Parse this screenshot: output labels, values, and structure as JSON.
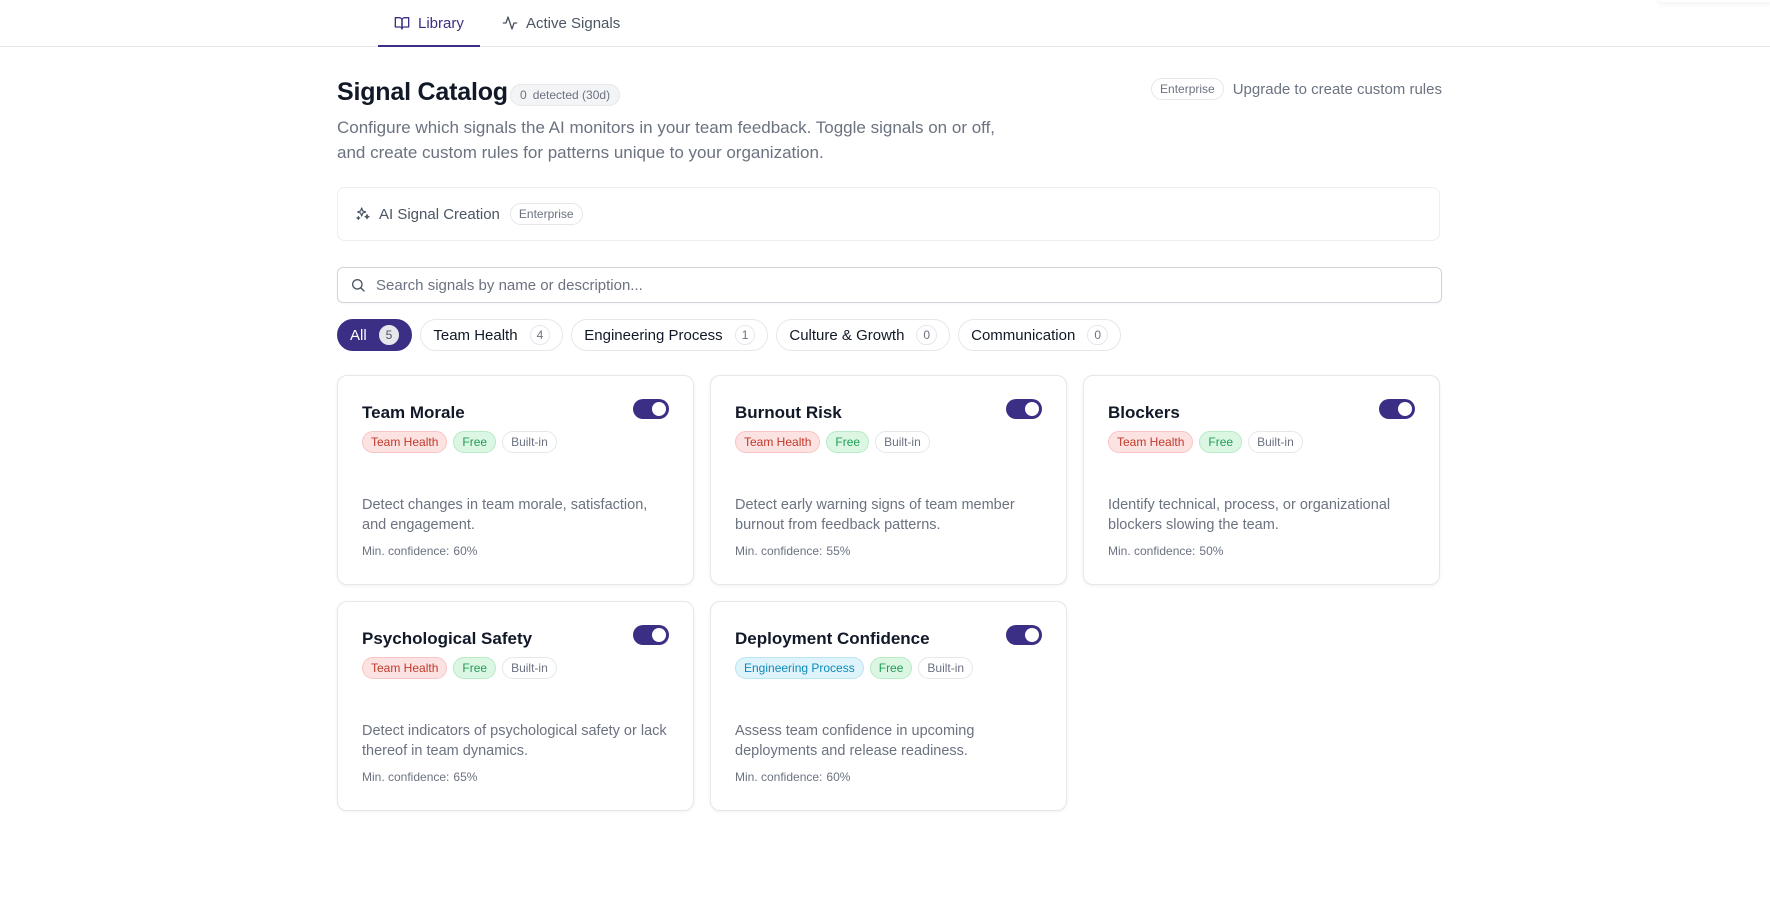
{
  "tabs": [
    {
      "label": "Library",
      "icon": "book-icon",
      "active": true
    },
    {
      "label": "Active Signals",
      "icon": "activity-icon",
      "active": false
    }
  ],
  "header": {
    "title": "Signal Catalog",
    "detected_count": "0",
    "detected_label": "detected (30d)",
    "subtitle": "Configure which signals the AI monitors in your team feedback. Toggle signals on or off, and create custom rules for patterns unique to your organization.",
    "upgrade_badge": "Enterprise",
    "upgrade_text": "Upgrade to create custom rules"
  },
  "ai_creation": {
    "label": "AI Signal Creation",
    "badge": "Enterprise",
    "icon": "sparkles-icon"
  },
  "search": {
    "placeholder": "Search signals by name or description...",
    "value": ""
  },
  "filters": [
    {
      "label": "All",
      "count": "5",
      "active": true
    },
    {
      "label": "Team Health",
      "count": "4",
      "active": false
    },
    {
      "label": "Engineering Process",
      "count": "1",
      "active": false
    },
    {
      "label": "Culture & Growth",
      "count": "0",
      "active": false
    },
    {
      "label": "Communication",
      "count": "0",
      "active": false
    }
  ],
  "confidence_label": "Min. confidence:",
  "signals": [
    {
      "title": "Team Morale",
      "category": "Team Health",
      "tier": "Free",
      "source": "Built-in",
      "description": "Detect changes in team morale, satisfaction, and engagement.",
      "confidence": "60%",
      "enabled": true
    },
    {
      "title": "Burnout Risk",
      "category": "Team Health",
      "tier": "Free",
      "source": "Built-in",
      "description": "Detect early warning signs of team member burnout from feedback patterns.",
      "confidence": "55%",
      "enabled": true
    },
    {
      "title": "Blockers",
      "category": "Team Health",
      "tier": "Free",
      "source": "Built-in",
      "description": "Identify technical, process, or organizational blockers slowing the team.",
      "confidence": "50%",
      "enabled": true
    },
    {
      "title": "Psychological Safety",
      "category": "Team Health",
      "tier": "Free",
      "source": "Built-in",
      "description": "Detect indicators of psychological safety or lack thereof in team dynamics.",
      "confidence": "65%",
      "enabled": true
    },
    {
      "title": "Deployment Confidence",
      "category": "Engineering Process",
      "tier": "Free",
      "source": "Built-in",
      "description": "Assess team confidence in upcoming deployments and release readiness.",
      "confidence": "60%",
      "enabled": true
    }
  ],
  "colors": {
    "accent": "#3b2f85",
    "team_health_tag": "#c0392b",
    "engineering_tag": "#0e8ab8",
    "free_tag": "#1f9d55"
  }
}
